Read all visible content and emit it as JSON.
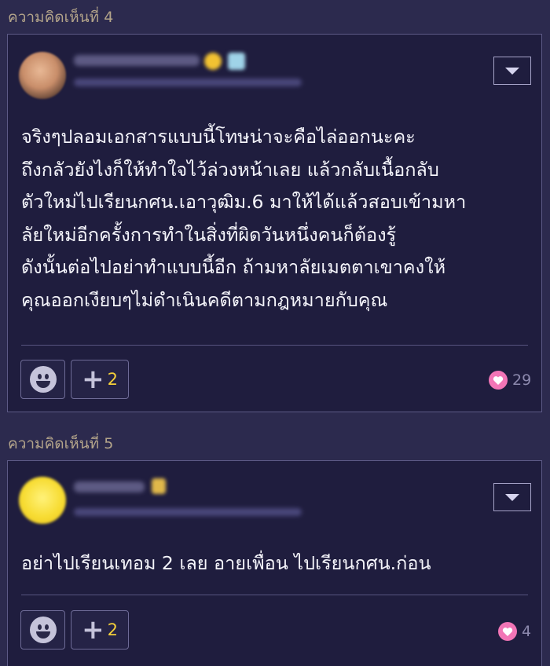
{
  "comments": [
    {
      "label": "ความคิดเห็นที่ 4",
      "text_lines": [
        "จริงๆปลอมเอกสารแบบนี้โทษน่าจะคือไล่ออกนะคะ",
        "ถึงกลัวยังไงก็ให้ทำใจไว้ล่วงหน้าเลย แล้วกลับเนื้อกลับ",
        "ตัวใหม่ไปเรียนกศน.เอาวุฒิม.6 มาให้ได้แล้วสอบเข้ามหา",
        "ลัยใหม่อีกครั้งการทำในสิ่งที่ผิดวันหนึ่งคนก็ต้องรู้",
        "ดังนั้นต่อไปอย่าทำแบบนี้อีก ถ้ามหาลัยเมตตาเขาคงให้",
        "คุณออกเงียบๆไม่ดำเนินคดีตามกฎหมายกับคุณ"
      ],
      "plus_count": "2",
      "like_count": "29",
      "icons": {
        "avatar": "user-photo-avatar",
        "menu": "chevron-down-icon",
        "emoji": "smile-emoji-icon",
        "plus": "plus-icon",
        "heart": "heart-icon"
      }
    },
    {
      "label": "ความคิดเห็นที่ 5",
      "text_lines": [
        "อย่าไปเรียนเทอม 2 เลย อายเพื่อน ไปเรียนกศน.ก่อน"
      ],
      "plus_count": "2",
      "like_count": "4",
      "icons": {
        "avatar": "smiley-avatar",
        "menu": "chevron-down-icon",
        "emoji": "smile-emoji-icon",
        "plus": "plus-icon",
        "heart": "heart-icon"
      }
    }
  ],
  "colors": {
    "background": "#2c2a4e",
    "card": "#1f1d3e",
    "label": "#b3a48a",
    "plus_count": "#f4cf3a",
    "heart": "#f275b6"
  }
}
